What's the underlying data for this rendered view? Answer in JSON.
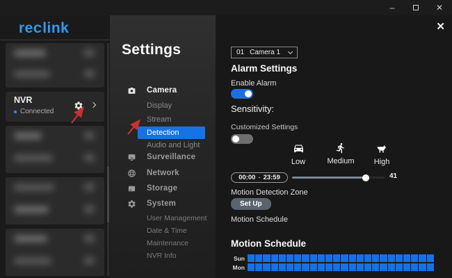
{
  "window": {
    "minimize_glyph": "–",
    "close_glyph": "✕",
    "dialog_close_glyph": "✕"
  },
  "sidebar": {
    "logo": {
      "pre": "re",
      "o": "o",
      "post": "link"
    },
    "nvr": {
      "name": "NVR",
      "status": "Connected"
    }
  },
  "settings_nav": {
    "title": "Settings",
    "camera": {
      "label": "Camera",
      "items": {
        "display": "Display",
        "stream": "Stream",
        "detection": "Detection",
        "audio": "Audio and Light"
      }
    },
    "surveillance": "Surveillance",
    "network": "Network",
    "storage": "Storage",
    "system": {
      "label": "System",
      "items": {
        "user": "User Management",
        "date": "Date & Time",
        "maintenance": "Maintenance",
        "nvr_info": "NVR Info"
      }
    }
  },
  "panel": {
    "camera_select": {
      "channel": "01",
      "name": "Camera 1"
    },
    "alarm_heading": "Alarm Settings",
    "enable_alarm": {
      "label": "Enable Alarm",
      "on": true
    },
    "sensitivity_heading": "Sensitivity:",
    "customized": {
      "label": "Customized Settings",
      "on": false
    },
    "sensitivity_levels": [
      {
        "type": "vehicle",
        "label": "Low"
      },
      {
        "type": "person",
        "label": "Medium"
      },
      {
        "type": "pet",
        "label": "High"
      }
    ],
    "time_range": {
      "start": "00:00",
      "sep": "-",
      "end": "23:59"
    },
    "slider": {
      "value": "41",
      "percent": 79
    },
    "motion_zone_label": "Motion Detection Zone",
    "setup_button": "Set Up",
    "motion_schedule_label": "Motion Schedule",
    "schedule": {
      "heading": "Motion Schedule",
      "rows": [
        "Sun",
        "Mon"
      ],
      "hours": 24
    }
  },
  "colors": {
    "accent_blue": "#1673e6",
    "logo_blue": "#2f9bf0",
    "schedule_cell_blue": "#1372ea",
    "connected_dot": "#2f7fe8",
    "annotation_red": "#c93030"
  }
}
